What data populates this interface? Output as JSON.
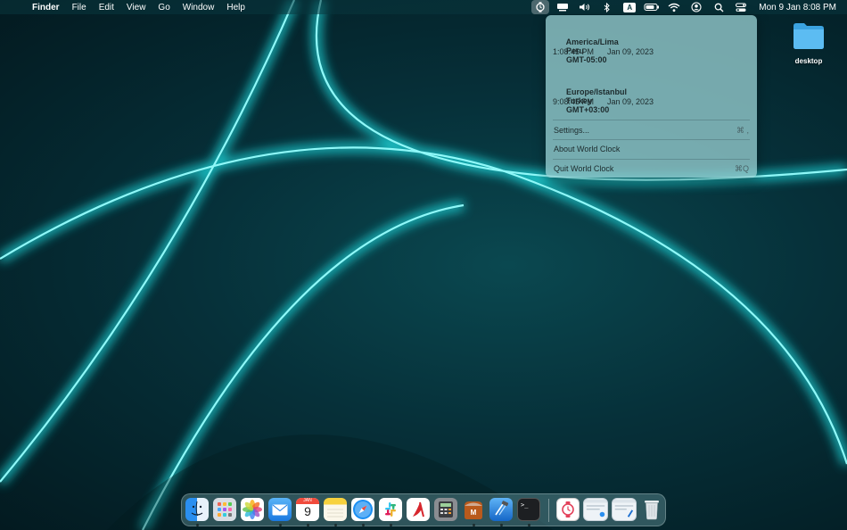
{
  "menubar": {
    "apple_glyph": "",
    "app_name": "Finder",
    "menus": [
      "File",
      "Edit",
      "View",
      "Go",
      "Window",
      "Help"
    ],
    "input_source": "A",
    "datetime": "Mon 9 Jan  8:08 PM"
  },
  "world_clock": {
    "zones": [
      {
        "region": "America/Lima",
        "country": "Peru",
        "offset": "GMT-05:00",
        "time": "1:08:45 PM",
        "date": "Jan 09, 2023"
      },
      {
        "region": "Europe/Istanbul",
        "country": "Turkey",
        "offset": "GMT+03:00",
        "time": "9:08:45 PM",
        "date": "Jan 09, 2023"
      }
    ],
    "menu": [
      {
        "label": "Settings...",
        "shortcut": "⌘ ,"
      },
      {
        "label": "About World Clock",
        "shortcut": ""
      },
      {
        "label": "Quit World Clock",
        "shortcut": "⌘Q"
      }
    ]
  },
  "desktop": {
    "folder_label": "desktop"
  },
  "dock": {
    "calendar_month": "JAN",
    "calendar_day": "9",
    "terminal_prompt": ">_",
    "icons": [
      "finder-icon",
      "launchpad-icon",
      "photos-icon",
      "mail-icon",
      "calendar-icon",
      "notes-icon",
      "safari-icon",
      "slack-icon",
      "pdf-reader-icon",
      "calculator-icon",
      "mamp-icon",
      "xcode-icon",
      "terminal-icon",
      "world-clock-icon",
      "window-thumbnail-icon",
      "window-thumbnail-icon-2",
      "trash-icon"
    ]
  }
}
